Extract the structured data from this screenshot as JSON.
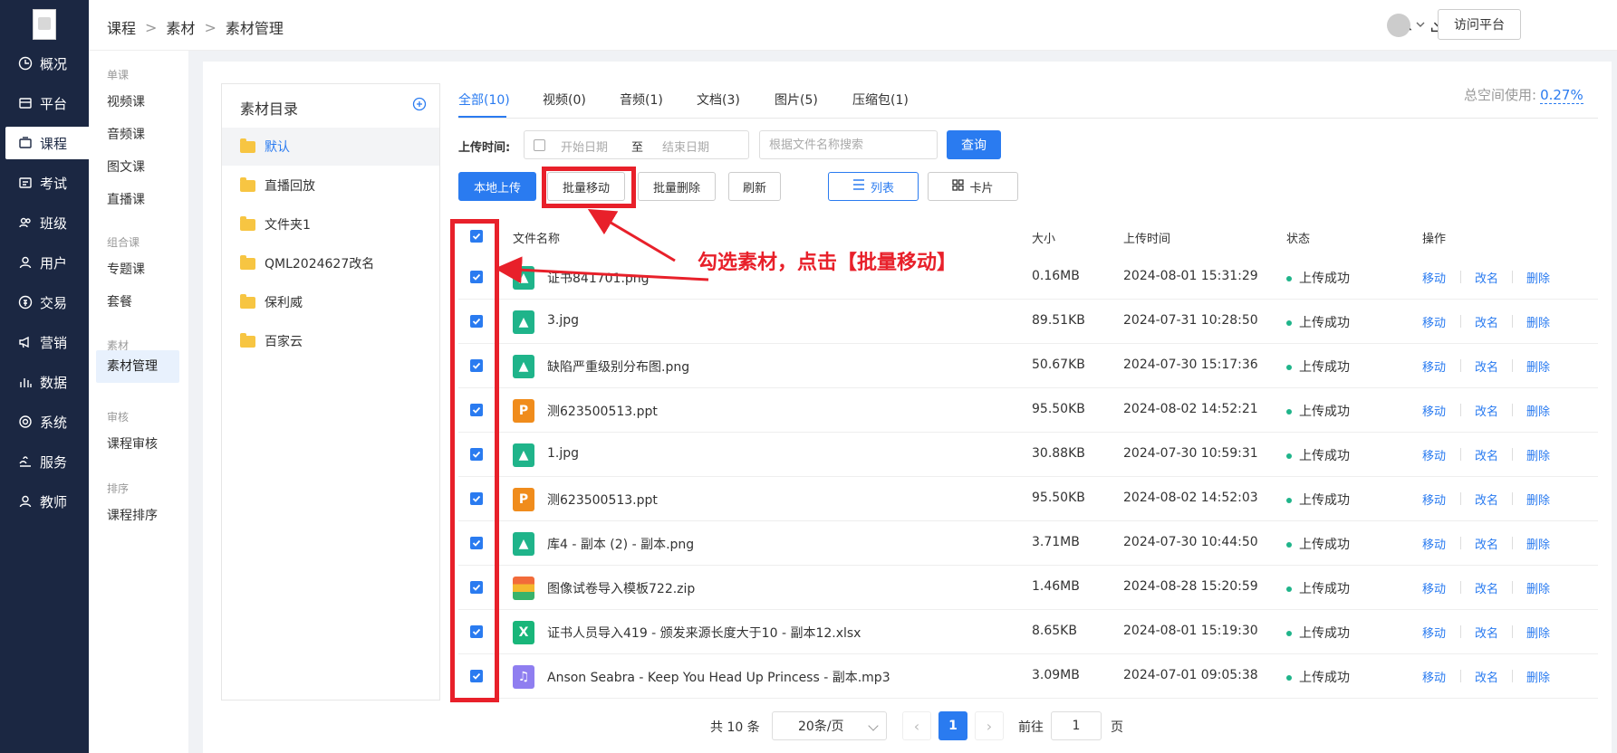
{
  "nav": {
    "items": [
      {
        "label": "概况",
        "icon": "clock-icon"
      },
      {
        "label": "平台",
        "icon": "store-icon"
      },
      {
        "label": "课程",
        "icon": "course-icon",
        "active": true
      },
      {
        "label": "考试",
        "icon": "exam-icon"
      },
      {
        "label": "班级",
        "icon": "class-icon"
      },
      {
        "label": "用户",
        "icon": "user-icon"
      },
      {
        "label": "交易",
        "icon": "trade-icon"
      },
      {
        "label": "营销",
        "icon": "megaphone-icon"
      },
      {
        "label": "数据",
        "icon": "bar-chart-icon"
      },
      {
        "label": "系统",
        "icon": "gear-icon"
      },
      {
        "label": "服务",
        "icon": "service-icon"
      },
      {
        "label": "教师",
        "icon": "teacher-icon"
      }
    ]
  },
  "submenu": {
    "groups": [
      {
        "title": "单课",
        "items": [
          "视频课",
          "音频课",
          "图文课",
          "直播课"
        ]
      },
      {
        "title": "组合课",
        "items": [
          "专题课",
          "套餐"
        ]
      },
      {
        "title": "素材",
        "items": [
          "素材管理"
        ]
      },
      {
        "title": "审核",
        "items": [
          "课程审核"
        ]
      },
      {
        "title": "排序",
        "items": [
          "课程排序"
        ]
      }
    ],
    "active": "素材管理"
  },
  "breadcrumb": [
    "课程",
    "素材",
    "素材管理"
  ],
  "header": {
    "visit_label": "访问平台"
  },
  "directory": {
    "title": "素材目录",
    "folders": [
      "默认",
      "直播回放",
      "文件夹1",
      "QML2024627改名",
      "保利威",
      "百家云"
    ],
    "active": "默认"
  },
  "tabs": [
    "全部(10)",
    "视频(0)",
    "音频(1)",
    "文档(3)",
    "图片(5)",
    "压缩包(1)"
  ],
  "space": {
    "label": "总空间使用:",
    "value": "0.27%"
  },
  "filter": {
    "label": "上传时间:",
    "start_placeholder": "开始日期",
    "to": "至",
    "end_placeholder": "结束日期",
    "search_placeholder": "根据文件名称搜索",
    "query_label": "查询"
  },
  "toolbar": {
    "upload": "本地上传",
    "batch_move": "批量移动",
    "batch_delete": "批量删除",
    "refresh": "刷新",
    "list_view": "列表",
    "card_view": "卡片"
  },
  "table": {
    "headers": [
      "文件名称",
      "大小",
      "上传时间",
      "状态",
      "操作"
    ],
    "ops": [
      "移动",
      "改名",
      "删除"
    ],
    "rows": [
      {
        "name": "证书841701.png",
        "type": "img",
        "size": "0.16MB",
        "time": "2024-08-01 15:31:29",
        "status": "上传成功"
      },
      {
        "name": "3.jpg",
        "type": "img",
        "size": "89.51KB",
        "time": "2024-07-31 10:28:50",
        "status": "上传成功"
      },
      {
        "name": "缺陷严重级别分布图.png",
        "type": "img",
        "size": "50.67KB",
        "time": "2024-07-30 15:17:36",
        "status": "上传成功"
      },
      {
        "name": "测623500513.ppt",
        "type": "ppt",
        "size": "95.50KB",
        "time": "2024-08-02 14:52:21",
        "status": "上传成功"
      },
      {
        "name": "1.jpg",
        "type": "img",
        "size": "30.88KB",
        "time": "2024-07-30 10:59:31",
        "status": "上传成功"
      },
      {
        "name": "测623500513.ppt",
        "type": "ppt",
        "size": "95.50KB",
        "time": "2024-08-02 14:52:03",
        "status": "上传成功"
      },
      {
        "name": "库4 - 副本 (2) - 副本.png",
        "type": "img",
        "size": "3.71MB",
        "time": "2024-07-30 10:44:50",
        "status": "上传成功"
      },
      {
        "name": "图像试卷导入模板722.zip",
        "type": "zip",
        "size": "1.46MB",
        "time": "2024-08-28 15:20:59",
        "status": "上传成功"
      },
      {
        "name": "证书人员导入419 - 颁发来源长度大于10 - 副本12.xlsx",
        "type": "xls",
        "size": "8.65KB",
        "time": "2024-08-01 15:19:30",
        "status": "上传成功"
      },
      {
        "name": "Anson Seabra - Keep You Head Up Princess - 副本.mp3",
        "type": "mp3",
        "size": "3.09MB",
        "time": "2024-07-01 09:05:38",
        "status": "上传成功"
      }
    ]
  },
  "pager": {
    "total": "共 10 条",
    "page_size": "20条/页",
    "current": "1",
    "goto_prefix": "前往",
    "goto_value": "1",
    "goto_suffix": "页"
  },
  "annotation": {
    "text": "勾选素材，点击【批量移动】",
    "color": "#e8202a"
  }
}
